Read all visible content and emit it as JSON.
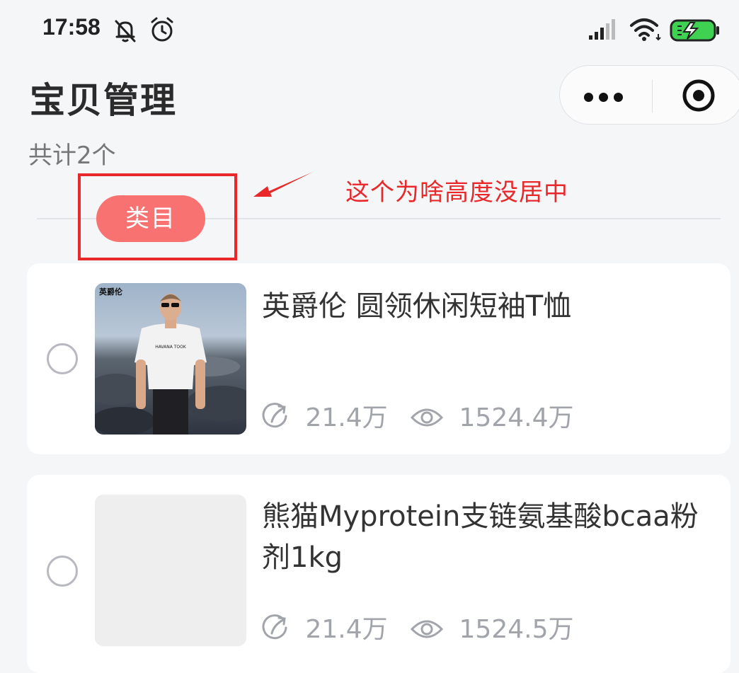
{
  "status_bar": {
    "time": "17:58",
    "icons": [
      "mute-bell-icon",
      "alarm-icon",
      "signal-icon",
      "wifi-icon",
      "battery-charging-icon"
    ]
  },
  "header": {
    "title": "宝贝管理",
    "capsule_icons": [
      "more-dots-icon",
      "close-target-icon"
    ]
  },
  "summary": {
    "total_text": "共计2个"
  },
  "category": {
    "label": "类目",
    "accent_color": "#f87272"
  },
  "annotation": {
    "text": "这个为啥高度没居中",
    "color": "#e8282a"
  },
  "products": [
    {
      "name": "英爵伦 圆领休闲短袖T恤",
      "shares": "21.4万",
      "views": "1524.4万",
      "thumb_brand": "英爵伦"
    },
    {
      "name": "熊猫Myprotein支链氨基酸bcaa粉剂1kg",
      "shares": "21.4万",
      "views": "1524.5万"
    }
  ]
}
